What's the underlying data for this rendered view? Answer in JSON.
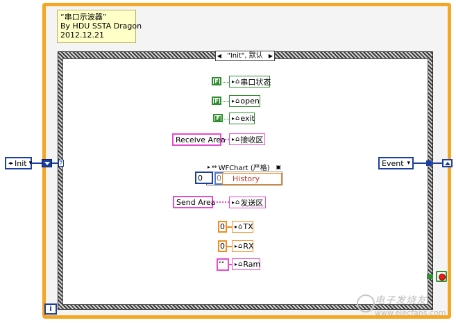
{
  "comment": {
    "line1": "“串口示波器”",
    "line2": "By HDU SSTA Dragon",
    "line3": "2012.12.21"
  },
  "case_selector": {
    "left_arrow": "◀",
    "label": "\"Init\", 默认",
    "right_arrow": "▶"
  },
  "init_enum": {
    "label": "Init",
    "dropdown": "▾",
    "arrow": "◂▸"
  },
  "event_enum": {
    "label": "Event",
    "dropdown": "▾"
  },
  "iteration_label": "i",
  "selector_q": "?",
  "bool_const": "F",
  "locals": {
    "serial_status": "串口状态",
    "open": "open",
    "exit": "exit",
    "receive_area": "接收区",
    "send_area": "发送区",
    "tx": "TX",
    "rx": "RX",
    "ram": "Ram"
  },
  "string_consts": {
    "receive_area": "Receive Area",
    "send_area": "Send Area",
    "empty": "\"\""
  },
  "num_consts": {
    "tx": "0",
    "rx": "0"
  },
  "property_node": {
    "title": "WFChart (严格)",
    "property": "History",
    "array_value": "0",
    "array_index": "0"
  },
  "watermark": {
    "top": "电子发烧友",
    "bottom": "www.elecfans.com"
  },
  "colors": {
    "loop_border": "#f5a623",
    "enum_blue": "#1a3fa0",
    "bool_green": "#2f8f2f",
    "string_pink": "#e84bd3",
    "numeric_orange": "#f28c1a",
    "comment_bg": "#ffffc8"
  }
}
